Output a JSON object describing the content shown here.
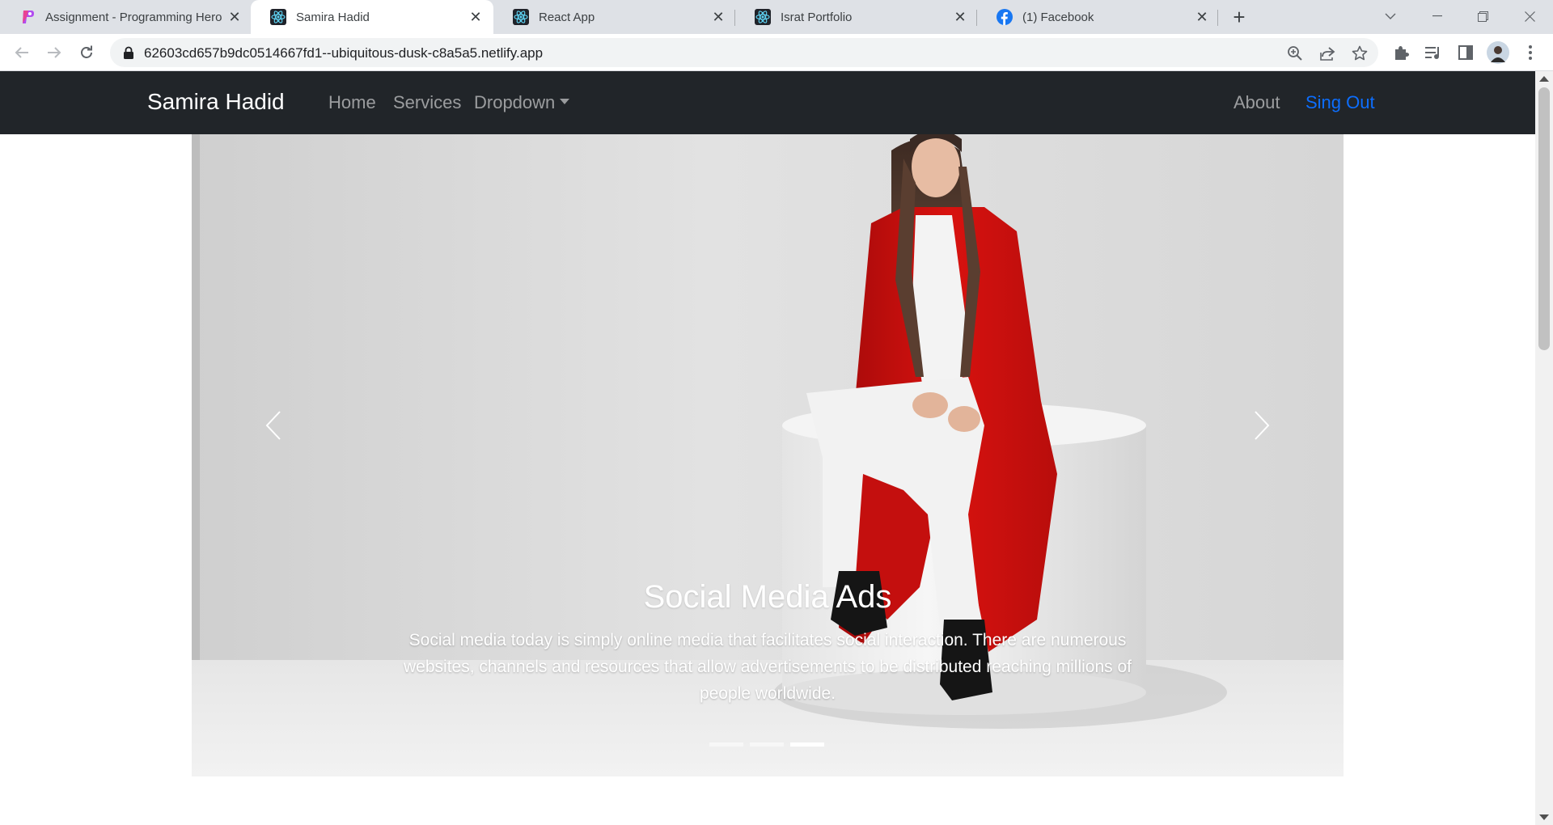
{
  "browser": {
    "tabs": [
      {
        "title": "Assignment - Programming Hero",
        "icon": "programming-hero-icon",
        "active": false
      },
      {
        "title": "Samira Hadid",
        "icon": "react-icon",
        "active": true
      },
      {
        "title": "React App",
        "icon": "react-icon",
        "active": false
      },
      {
        "title": "Israt Portfolio",
        "icon": "react-icon",
        "active": false
      },
      {
        "title": "(1) Facebook",
        "icon": "facebook-icon",
        "active": false
      }
    ],
    "url": "62603cd657b9dc0514667fd1--ubiquitous-dusk-c8a5a5.netlify.app"
  },
  "navbar": {
    "brand": "Samira Hadid",
    "links": [
      "Home",
      "Services",
      "Dropdown"
    ],
    "right_links": [
      "About",
      "Sing Out"
    ]
  },
  "carousel": {
    "caption_title": "Social Media Ads",
    "caption_text": "Social media today is simply online media that facilitates social interaction. There are numerous websites, channels and resources that allow advertisements to be distributed reaching millions of people worldwide.",
    "slide_count": 3,
    "active_index": 2
  },
  "colors": {
    "navbar_bg": "#212529",
    "primary": "#0d6efd",
    "coat_red": "#d0100f"
  }
}
